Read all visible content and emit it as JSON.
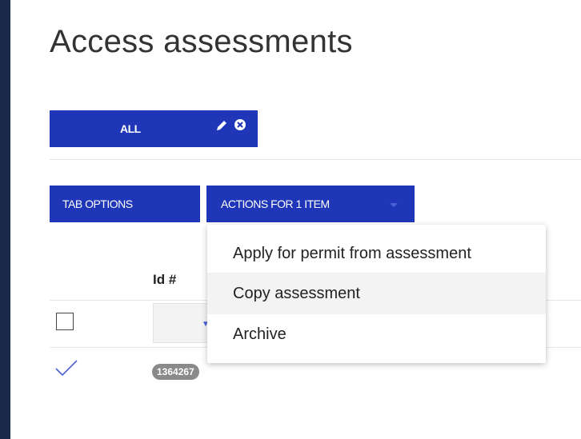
{
  "page": {
    "title": "Access assessments"
  },
  "view_tab": {
    "label": "ALL",
    "edit_icon": "pencil-icon",
    "remove_icon": "close-circle-icon"
  },
  "toolbar": {
    "tab_options_label": "TAB OPTIONS",
    "actions_label": "ACTIONS FOR 1 ITEM"
  },
  "dropdown": {
    "items": [
      {
        "label": "Apply for permit from assessment"
      },
      {
        "label": "Copy assessment"
      },
      {
        "label": "Archive"
      }
    ]
  },
  "table": {
    "columns": [
      {
        "label": "Id #"
      }
    ],
    "rows": [
      {
        "selected": true,
        "id": "1364267"
      }
    ]
  },
  "colors": {
    "accent": "#1f36b8",
    "left_rail": "#1a2a4a",
    "badge": "#8a8a8a"
  }
}
